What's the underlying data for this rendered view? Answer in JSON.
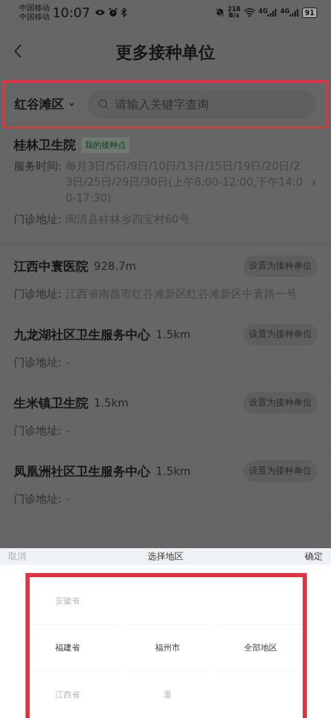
{
  "status_bar": {
    "carriers": [
      "中国移动",
      "中国移动"
    ],
    "time": "10:07",
    "net_speed": {
      "value": "218",
      "unit": "B/s"
    },
    "signals": [
      {
        "label": "4G"
      },
      {
        "label": "4G"
      }
    ],
    "battery": "91"
  },
  "header": {
    "title": "更多接种单位"
  },
  "filter": {
    "highlighted": true,
    "region": "红谷滩区",
    "search": {
      "placeholder": "请输入关键字查询"
    }
  },
  "my_unit": {
    "name": "桂林卫生院",
    "tag": "我的接种点",
    "service_time": {
      "label": "服务时间:",
      "value": "每月3日/5日/9日/10日/13日/15日/19日/20日/23日/25日/29日/30日(上午8:00-12:00,下午14:00-17:30)"
    },
    "address": {
      "label": "门诊地址:",
      "value": "闽清县桂林乡四宝村60号"
    }
  },
  "units": [
    {
      "name": "江西中寰医院",
      "distance": "928.7m",
      "button": "设置为接种单位",
      "address_label": "门诊地址:",
      "address": "江西省南昌市红谷滩新区红谷滩新区中寰路一号"
    },
    {
      "name": "九龙湖社区卫生服务中心",
      "distance": "1.5km",
      "button": "设置为接种单位",
      "address_label": "门诊地址:",
      "address": "-"
    },
    {
      "name": "生米镇卫生院",
      "distance": "1.5km",
      "button": "设置为接种单位",
      "address_label": "门诊地址:",
      "address": "-"
    },
    {
      "name": "凤凰洲社区卫生服务中心",
      "distance": "1.5km",
      "button": "设置为接种单位",
      "address_label": "门诊地址:",
      "address": "-"
    }
  ],
  "picker": {
    "cancel": "取消",
    "title": "选择地区",
    "confirm": "确定",
    "highlighted": true,
    "columns": [
      {
        "items": [
          {
            "label": "安徽省",
            "selected": false
          },
          {
            "label": "福建省",
            "selected": true
          },
          {
            "label": "江西省",
            "selected": false
          }
        ]
      },
      {
        "items": [
          {
            "label": "福州市",
            "selected": true
          },
          {
            "label": "厦",
            "selected": false
          }
        ]
      },
      {
        "items": [
          {
            "label": "全部地区",
            "selected": true
          }
        ]
      }
    ]
  }
}
